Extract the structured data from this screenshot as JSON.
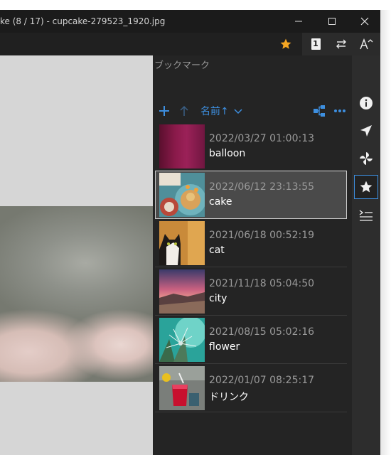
{
  "window": {
    "title": "ke (8 / 17) - cupcake-279523_1920.jpg",
    "controls": {
      "minimize": "—",
      "maximize": "☐",
      "close": "✕"
    }
  },
  "toolbar": {
    "page_number": "1"
  },
  "bookmark_panel": {
    "title": "ブックマーク",
    "sort_label": "名前↑",
    "items": [
      {
        "date": "2022/03/27 01:00:13",
        "name": "balloon",
        "selected": false
      },
      {
        "date": "2022/06/12 23:13:55",
        "name": "cake",
        "selected": true
      },
      {
        "date": "2021/06/18 00:52:19",
        "name": "cat",
        "selected": false
      },
      {
        "date": "2021/11/18 05:04:50",
        "name": "city",
        "selected": false
      },
      {
        "date": "2021/08/15 05:02:16",
        "name": "flower",
        "selected": false
      },
      {
        "date": "2022/01/07 08:25:17",
        "name": "ドリンク",
        "selected": false
      }
    ]
  },
  "colors": {
    "accent": "#3d8fe0",
    "star": "#f5a623",
    "panel_bg": "#242424",
    "viewer_bg": "#d6d6d6"
  },
  "sidebar_icons": [
    "info-icon",
    "navigate-icon",
    "pinwheel-icon",
    "bookmark-star-icon",
    "history-list-icon"
  ]
}
